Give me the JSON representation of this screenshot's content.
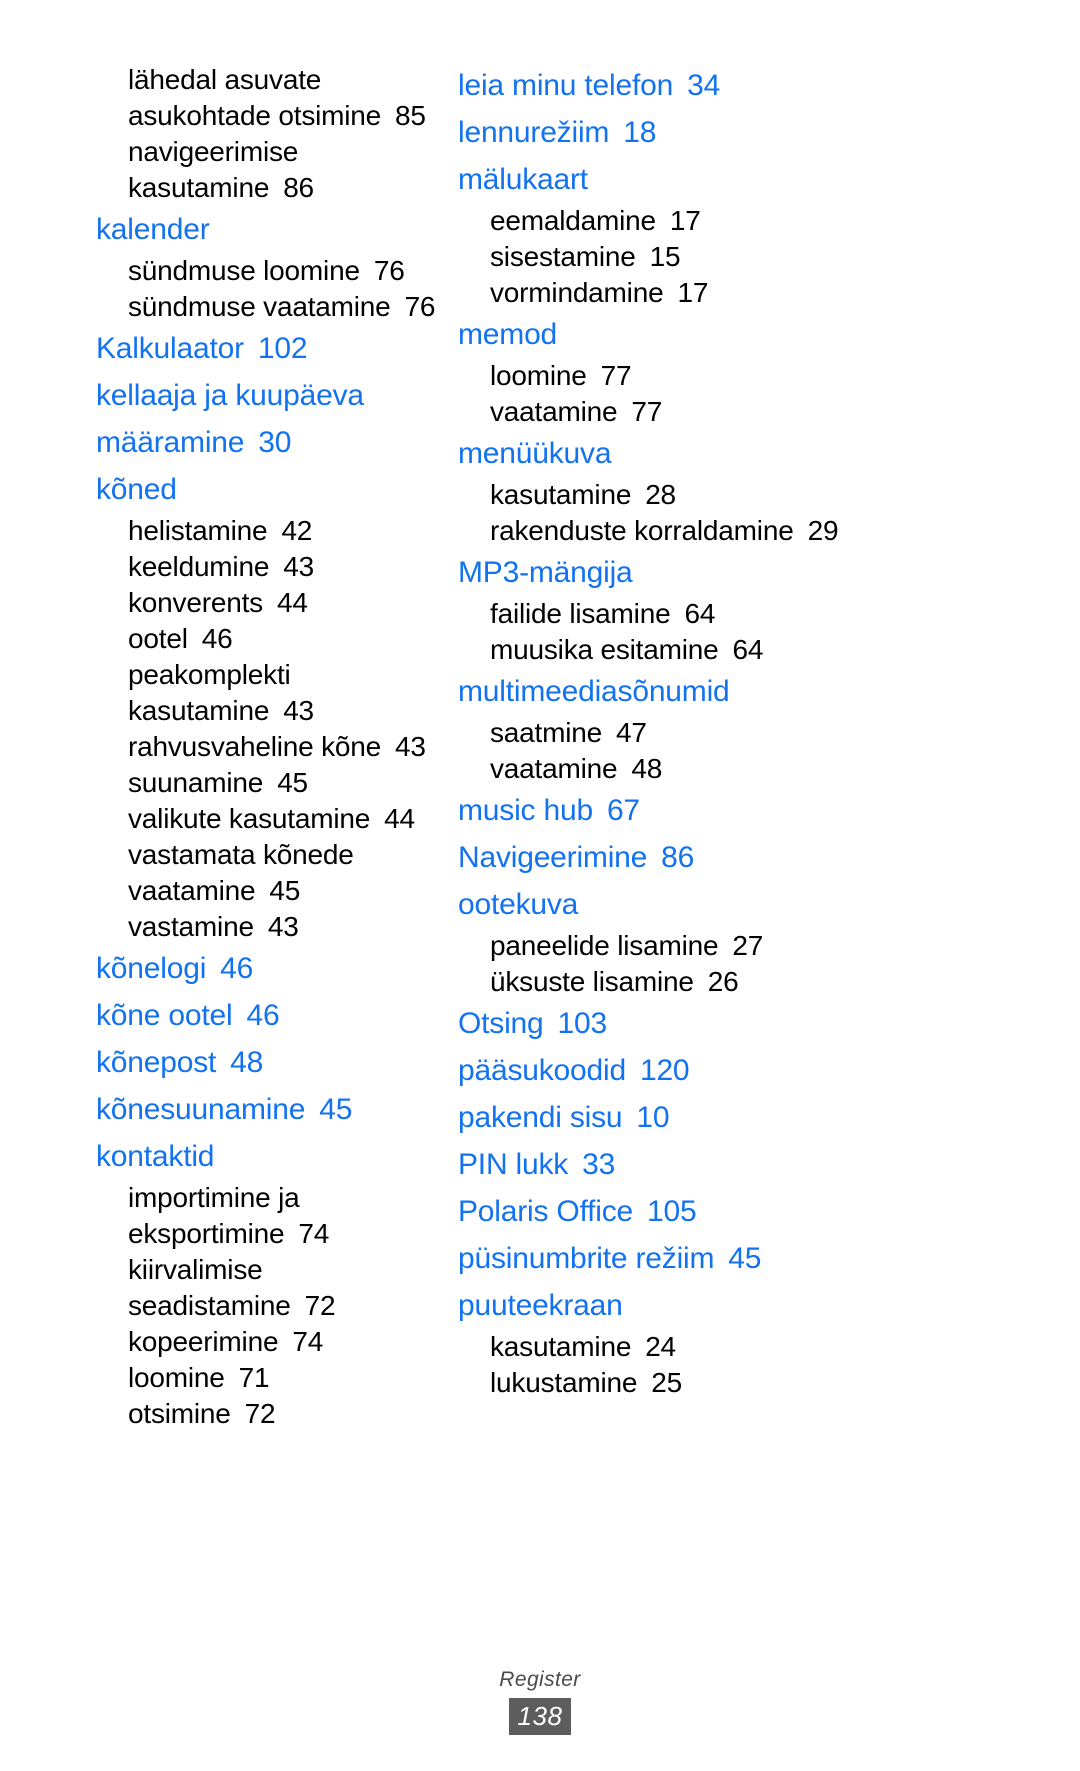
{
  "document": {
    "footer_title": "Register",
    "page_number": "138",
    "heading_color": "#1272f0",
    "body_color": "#000000",
    "footer_badge_color": "#5d5d5d"
  },
  "left_column": [
    {
      "type": "sub",
      "label": "lähedal asuvate asukohtade otsimine",
      "page": "85"
    },
    {
      "type": "sub",
      "label": "navigeerimise kasutamine",
      "page": "86"
    },
    {
      "type": "main",
      "label": "kalender",
      "page": ""
    },
    {
      "type": "sub",
      "label": "sündmuse loomine",
      "page": "76"
    },
    {
      "type": "sub",
      "label": "sündmuse vaatamine",
      "page": "76"
    },
    {
      "type": "main",
      "label": "Kalkulaator",
      "page": "102"
    },
    {
      "type": "main",
      "label": "kellaaja ja kuupäeva määramine",
      "page": "30"
    },
    {
      "type": "main",
      "label": "kõned",
      "page": ""
    },
    {
      "type": "sub",
      "label": "helistamine",
      "page": "42"
    },
    {
      "type": "sub",
      "label": "keeldumine",
      "page": "43"
    },
    {
      "type": "sub",
      "label": "konverents",
      "page": "44"
    },
    {
      "type": "sub",
      "label": "ootel",
      "page": "46"
    },
    {
      "type": "sub",
      "label": "peakomplekti kasutamine",
      "page": "43"
    },
    {
      "type": "sub",
      "label": "rahvusvaheline kõne",
      "page": "43"
    },
    {
      "type": "sub",
      "label": "suunamine",
      "page": "45"
    },
    {
      "type": "sub",
      "label": "valikute kasutamine",
      "page": "44"
    },
    {
      "type": "sub",
      "label": "vastamata kõnede vaatamine",
      "page": "45"
    },
    {
      "type": "sub",
      "label": "vastamine",
      "page": "43"
    },
    {
      "type": "main",
      "label": "kõnelogi",
      "page": "46"
    },
    {
      "type": "main",
      "label": "kõne ootel",
      "page": "46"
    },
    {
      "type": "main",
      "label": "kõnepost",
      "page": "48"
    },
    {
      "type": "main",
      "label": "kõnesuunamine",
      "page": "45"
    },
    {
      "type": "main",
      "label": "kontaktid",
      "page": ""
    },
    {
      "type": "sub",
      "label": "importimine ja eksportimine",
      "page": "74"
    },
    {
      "type": "sub",
      "label": "kiirvalimise seadistamine",
      "page": "72"
    },
    {
      "type": "sub",
      "label": "kopeerimine",
      "page": "74"
    },
    {
      "type": "sub",
      "label": "loomine",
      "page": "71"
    },
    {
      "type": "sub",
      "label": "otsimine",
      "page": "72"
    }
  ],
  "right_column": [
    {
      "type": "main",
      "label": "leia minu telefon",
      "page": "34"
    },
    {
      "type": "main",
      "label": "lennurežiim",
      "page": "18"
    },
    {
      "type": "main",
      "label": "mälukaart",
      "page": ""
    },
    {
      "type": "sub",
      "label": "eemaldamine",
      "page": "17"
    },
    {
      "type": "sub",
      "label": "sisestamine",
      "page": "15"
    },
    {
      "type": "sub",
      "label": "vormindamine",
      "page": "17"
    },
    {
      "type": "main",
      "label": "memod",
      "page": ""
    },
    {
      "type": "sub",
      "label": "loomine",
      "page": "77"
    },
    {
      "type": "sub",
      "label": "vaatamine",
      "page": "77"
    },
    {
      "type": "main",
      "label": "menüükuva",
      "page": ""
    },
    {
      "type": "sub",
      "label": "kasutamine",
      "page": "28"
    },
    {
      "type": "sub",
      "label": "rakenduste korraldamine",
      "page": "29"
    },
    {
      "type": "main",
      "label": "MP3-mängija",
      "page": ""
    },
    {
      "type": "sub",
      "label": "failide lisamine",
      "page": "64"
    },
    {
      "type": "sub",
      "label": "muusika esitamine",
      "page": "64"
    },
    {
      "type": "main",
      "label": "multimeediasõnumid",
      "page": ""
    },
    {
      "type": "sub",
      "label": "saatmine",
      "page": "47"
    },
    {
      "type": "sub",
      "label": "vaatamine",
      "page": "48"
    },
    {
      "type": "main",
      "label": "music hub",
      "page": "67"
    },
    {
      "type": "main",
      "label": "Navigeerimine",
      "page": "86"
    },
    {
      "type": "main",
      "label": "ootekuva",
      "page": ""
    },
    {
      "type": "sub",
      "label": "paneelide lisamine",
      "page": "27"
    },
    {
      "type": "sub",
      "label": "üksuste lisamine",
      "page": "26"
    },
    {
      "type": "main",
      "label": "Otsing",
      "page": "103"
    },
    {
      "type": "main",
      "label": "pääsukoodid",
      "page": "120"
    },
    {
      "type": "main",
      "label": "pakendi sisu",
      "page": "10"
    },
    {
      "type": "main",
      "label": "PIN lukk",
      "page": "33"
    },
    {
      "type": "main",
      "label": "Polaris Office",
      "page": "105"
    },
    {
      "type": "main",
      "label": "püsinumbrite režiim",
      "page": "45"
    },
    {
      "type": "main",
      "label": "puuteekraan",
      "page": ""
    },
    {
      "type": "sub",
      "label": "kasutamine",
      "page": "24"
    },
    {
      "type": "sub",
      "label": "lukustamine",
      "page": "25"
    }
  ]
}
